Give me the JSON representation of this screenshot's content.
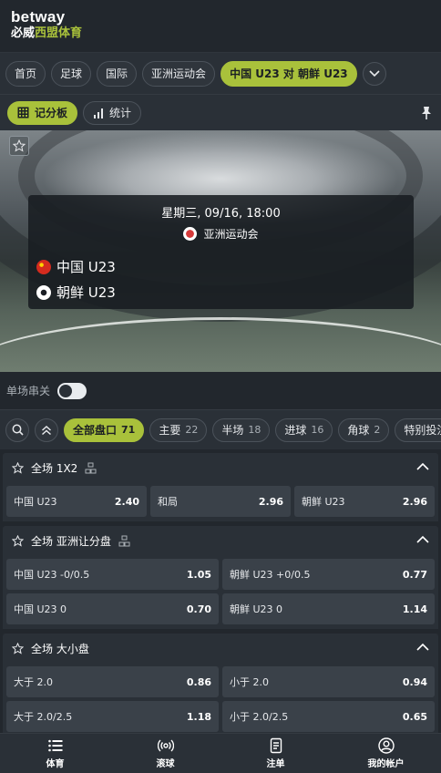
{
  "brand": {
    "name": "betway",
    "sub_white": "必威",
    "sub_green": "西盟体育"
  },
  "breadcrumbs": [
    "首页",
    "足球",
    "国际",
    "亚洲运动会",
    "中国 U23 对 朝鲜 U23"
  ],
  "subtabs": {
    "scoreboard": "记分板",
    "stats": "统计"
  },
  "match": {
    "datetime": "星期三, 09/16, 18:00",
    "competition": "亚洲运动会",
    "home": "中国 U23",
    "away": "朝鲜 U23"
  },
  "single_bet_label": "单场串关",
  "filters": [
    {
      "label": "全部盘口",
      "count": "71"
    },
    {
      "label": "主要",
      "count": "22"
    },
    {
      "label": "半场",
      "count": "18"
    },
    {
      "label": "进球",
      "count": "16"
    },
    {
      "label": "角球",
      "count": "2"
    },
    {
      "label": "特别投注",
      "count": ""
    }
  ],
  "markets": [
    {
      "title": "全场 1X2",
      "rows": [
        [
          {
            "label": "中国 U23",
            "price": "2.40"
          },
          {
            "label": "和局",
            "price": "2.96"
          },
          {
            "label": "朝鲜 U23",
            "price": "2.96"
          }
        ]
      ]
    },
    {
      "title": "全场 亚洲让分盘",
      "rows": [
        [
          {
            "label": "中国 U23  -0/0.5",
            "price": "1.05"
          },
          {
            "label": "朝鲜 U23 +0/0.5",
            "price": "0.77"
          }
        ],
        [
          {
            "label": "中国 U23  0",
            "price": "0.70"
          },
          {
            "label": "朝鲜 U23  0",
            "price": "1.14"
          }
        ]
      ]
    },
    {
      "title": "全场 大小盘",
      "rows": [
        [
          {
            "label": "大于 2.0",
            "price": "0.86"
          },
          {
            "label": "小于 2.0",
            "price": "0.94"
          }
        ],
        [
          {
            "label": "大于 2.0/2.5",
            "price": "1.18"
          },
          {
            "label": "小于 2.0/2.5",
            "price": "0.65"
          }
        ]
      ]
    }
  ],
  "bottom_nav": [
    "体育",
    "滚球",
    "注单",
    "我的帐户"
  ],
  "colors": {
    "accent": "#a9c13b",
    "background": "#22272d",
    "panel": "#2a3037",
    "odds_button": "#3a4149"
  }
}
